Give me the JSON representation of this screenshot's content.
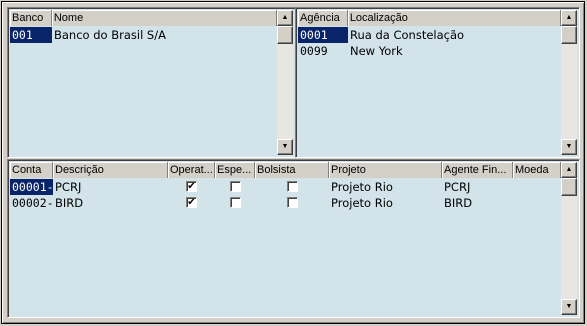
{
  "bancos": {
    "columns": [
      "Banco",
      "Nome"
    ],
    "rows": [
      {
        "banco": "001",
        "nome": "Banco do Brasil S/A",
        "selected": true
      }
    ]
  },
  "agencias": {
    "columns": [
      "Agência",
      "Localização"
    ],
    "rows": [
      {
        "agencia": "0001",
        "localizacao": "Rua da Constelação",
        "selected": true
      },
      {
        "agencia": "0099",
        "localizacao": "New York",
        "selected": false
      }
    ]
  },
  "contas": {
    "columns": [
      "Conta",
      "Descrição",
      "Operat...",
      "Espe...",
      "Bolsista",
      "Projeto",
      "Agente Fin...",
      "Moeda"
    ],
    "rows": [
      {
        "conta": "00001-",
        "descricao": "PCRJ",
        "operat": true,
        "espe": false,
        "bolsista": false,
        "projeto": "Projeto Rio",
        "agente": "PCRJ",
        "moeda": "",
        "selected": true
      },
      {
        "conta": "00002-",
        "descricao": "BIRD",
        "operat": true,
        "espe": false,
        "bolsista": false,
        "projeto": "Projeto Rio",
        "agente": "BIRD",
        "moeda": "",
        "selected": false
      }
    ]
  },
  "icons": {
    "scroll_up": "arrow-up-icon",
    "scroll_down": "arrow-down-icon",
    "check": "checkmark-icon"
  },
  "colors": {
    "grid_bg": "#d2e3ea",
    "selection": "#0a246a",
    "window": "#d4d0c8"
  }
}
